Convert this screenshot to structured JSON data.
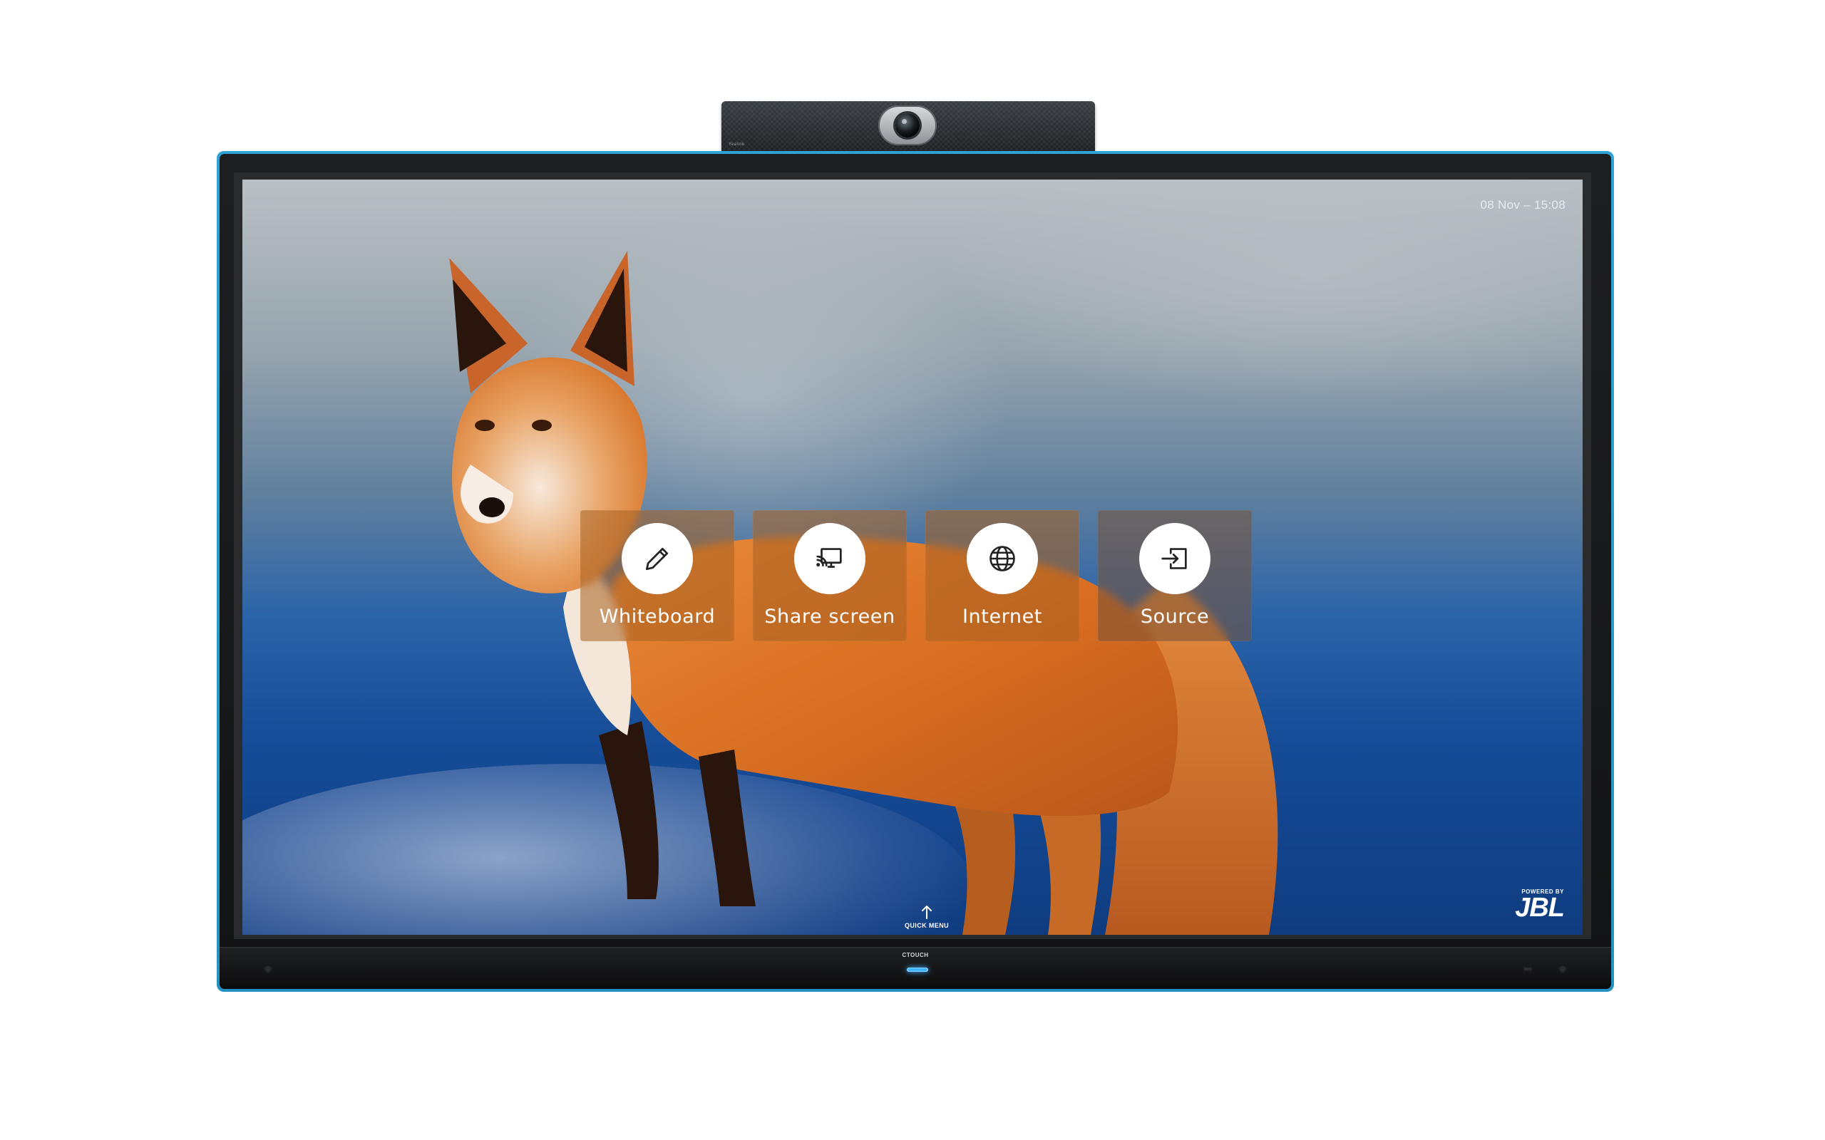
{
  "screen": {
    "datetime": "08 Nov – 15:08",
    "tiles": [
      {
        "label": "Whiteboard",
        "icon": "pencil-icon"
      },
      {
        "label": "Share screen",
        "icon": "cast-screen-icon"
      },
      {
        "label": "Internet",
        "icon": "globe-icon"
      },
      {
        "label": "Source",
        "icon": "input-source-icon"
      }
    ],
    "quick_menu": {
      "label": "QUICK MENU",
      "icon": "arrow-up-icon"
    },
    "jbl": {
      "powered_by": "POWERED BY",
      "logo": "JBL"
    }
  },
  "device": {
    "brand": "CTOUCH",
    "camera_brand": "Yealink",
    "frame_color": "#2fa3d6",
    "led_color": "#3fb3ff"
  }
}
